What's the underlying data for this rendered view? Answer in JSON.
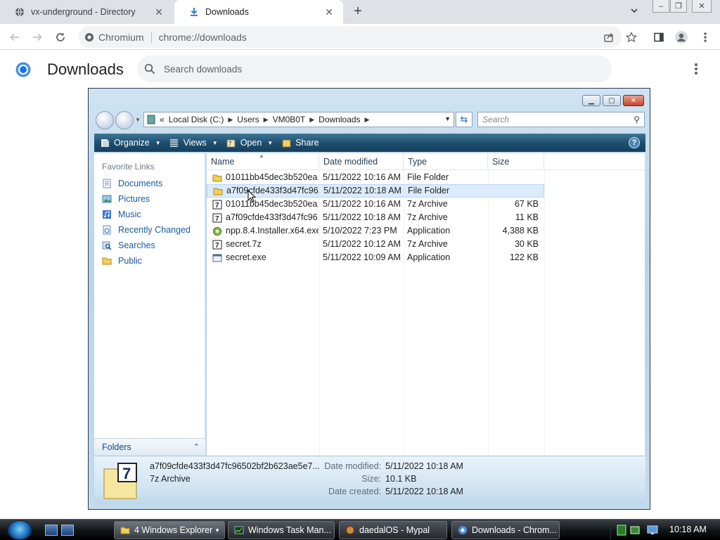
{
  "browser": {
    "tabs": [
      {
        "title": "vx-underground - Directory",
        "icon": "globe-icon"
      },
      {
        "title": "Downloads",
        "icon": "download-icon"
      }
    ],
    "omnibox": {
      "site": "Chromium",
      "url": "chrome://downloads"
    }
  },
  "downloads_page": {
    "title": "Downloads",
    "search_placeholder": "Search downloads"
  },
  "explorer": {
    "breadcrumb": [
      "Local Disk (C:)",
      "Users",
      "VM0B0T",
      "Downloads"
    ],
    "search_placeholder": "Search",
    "commands": {
      "organize": "Organize",
      "views": "Views",
      "open": "Open",
      "share": "Share"
    },
    "favorite_links_header": "Favorite Links",
    "favorite_links": [
      "Documents",
      "Pictures",
      "Music",
      "Recently Changed",
      "Searches",
      "Public"
    ],
    "folders_label": "Folders",
    "columns": {
      "name": "Name",
      "date": "Date modified",
      "type": "Type",
      "size": "Size"
    },
    "files": [
      {
        "name": "01011bb45dec3b520ea...",
        "date": "5/11/2022 10:16 AM",
        "type": "File Folder",
        "size": "",
        "kind": "folder"
      },
      {
        "name": "a7f09cfde433f3d47fc96...",
        "date": "5/11/2022 10:18 AM",
        "type": "File Folder",
        "size": "",
        "kind": "folder"
      },
      {
        "name": "01011bb45dec3b520ea...",
        "date": "5/11/2022 10:16 AM",
        "type": "7z Archive",
        "size": "67 KB",
        "kind": "archive"
      },
      {
        "name": "a7f09cfde433f3d47fc96...",
        "date": "5/11/2022 10:18 AM",
        "type": "7z Archive",
        "size": "11 KB",
        "kind": "archive"
      },
      {
        "name": "npp.8.4.Installer.x64.exe",
        "date": "5/10/2022 7:23 PM",
        "type": "Application",
        "size": "4,388 KB",
        "kind": "installer"
      },
      {
        "name": "secret.7z",
        "date": "5/11/2022 10:12 AM",
        "type": "7z Archive",
        "size": "30 KB",
        "kind": "archive"
      },
      {
        "name": "secret.exe",
        "date": "5/11/2022 10:09 AM",
        "type": "Application",
        "size": "122 KB",
        "kind": "app"
      }
    ],
    "details": {
      "name": "a7f09cfde433f3d47fc96502bf2b623ae5e7...",
      "type": "7z Archive",
      "date_modified_label": "Date modified:",
      "date_modified": "5/11/2022 10:18 AM",
      "size_label": "Size:",
      "size": "10.1 KB",
      "date_created_label": "Date created:",
      "date_created": "5/11/2022 10:18 AM"
    }
  },
  "taskbar": {
    "tasks": [
      "4 Windows Explorer",
      "Windows Task Man...",
      "daedalOS - Mypal",
      "Downloads - Chrom..."
    ],
    "clock": "10:18 AM"
  },
  "colors": {
    "accent": "#1a73e8",
    "explorer_link": "#1b5aa5",
    "command_bar": "#1f5070"
  }
}
